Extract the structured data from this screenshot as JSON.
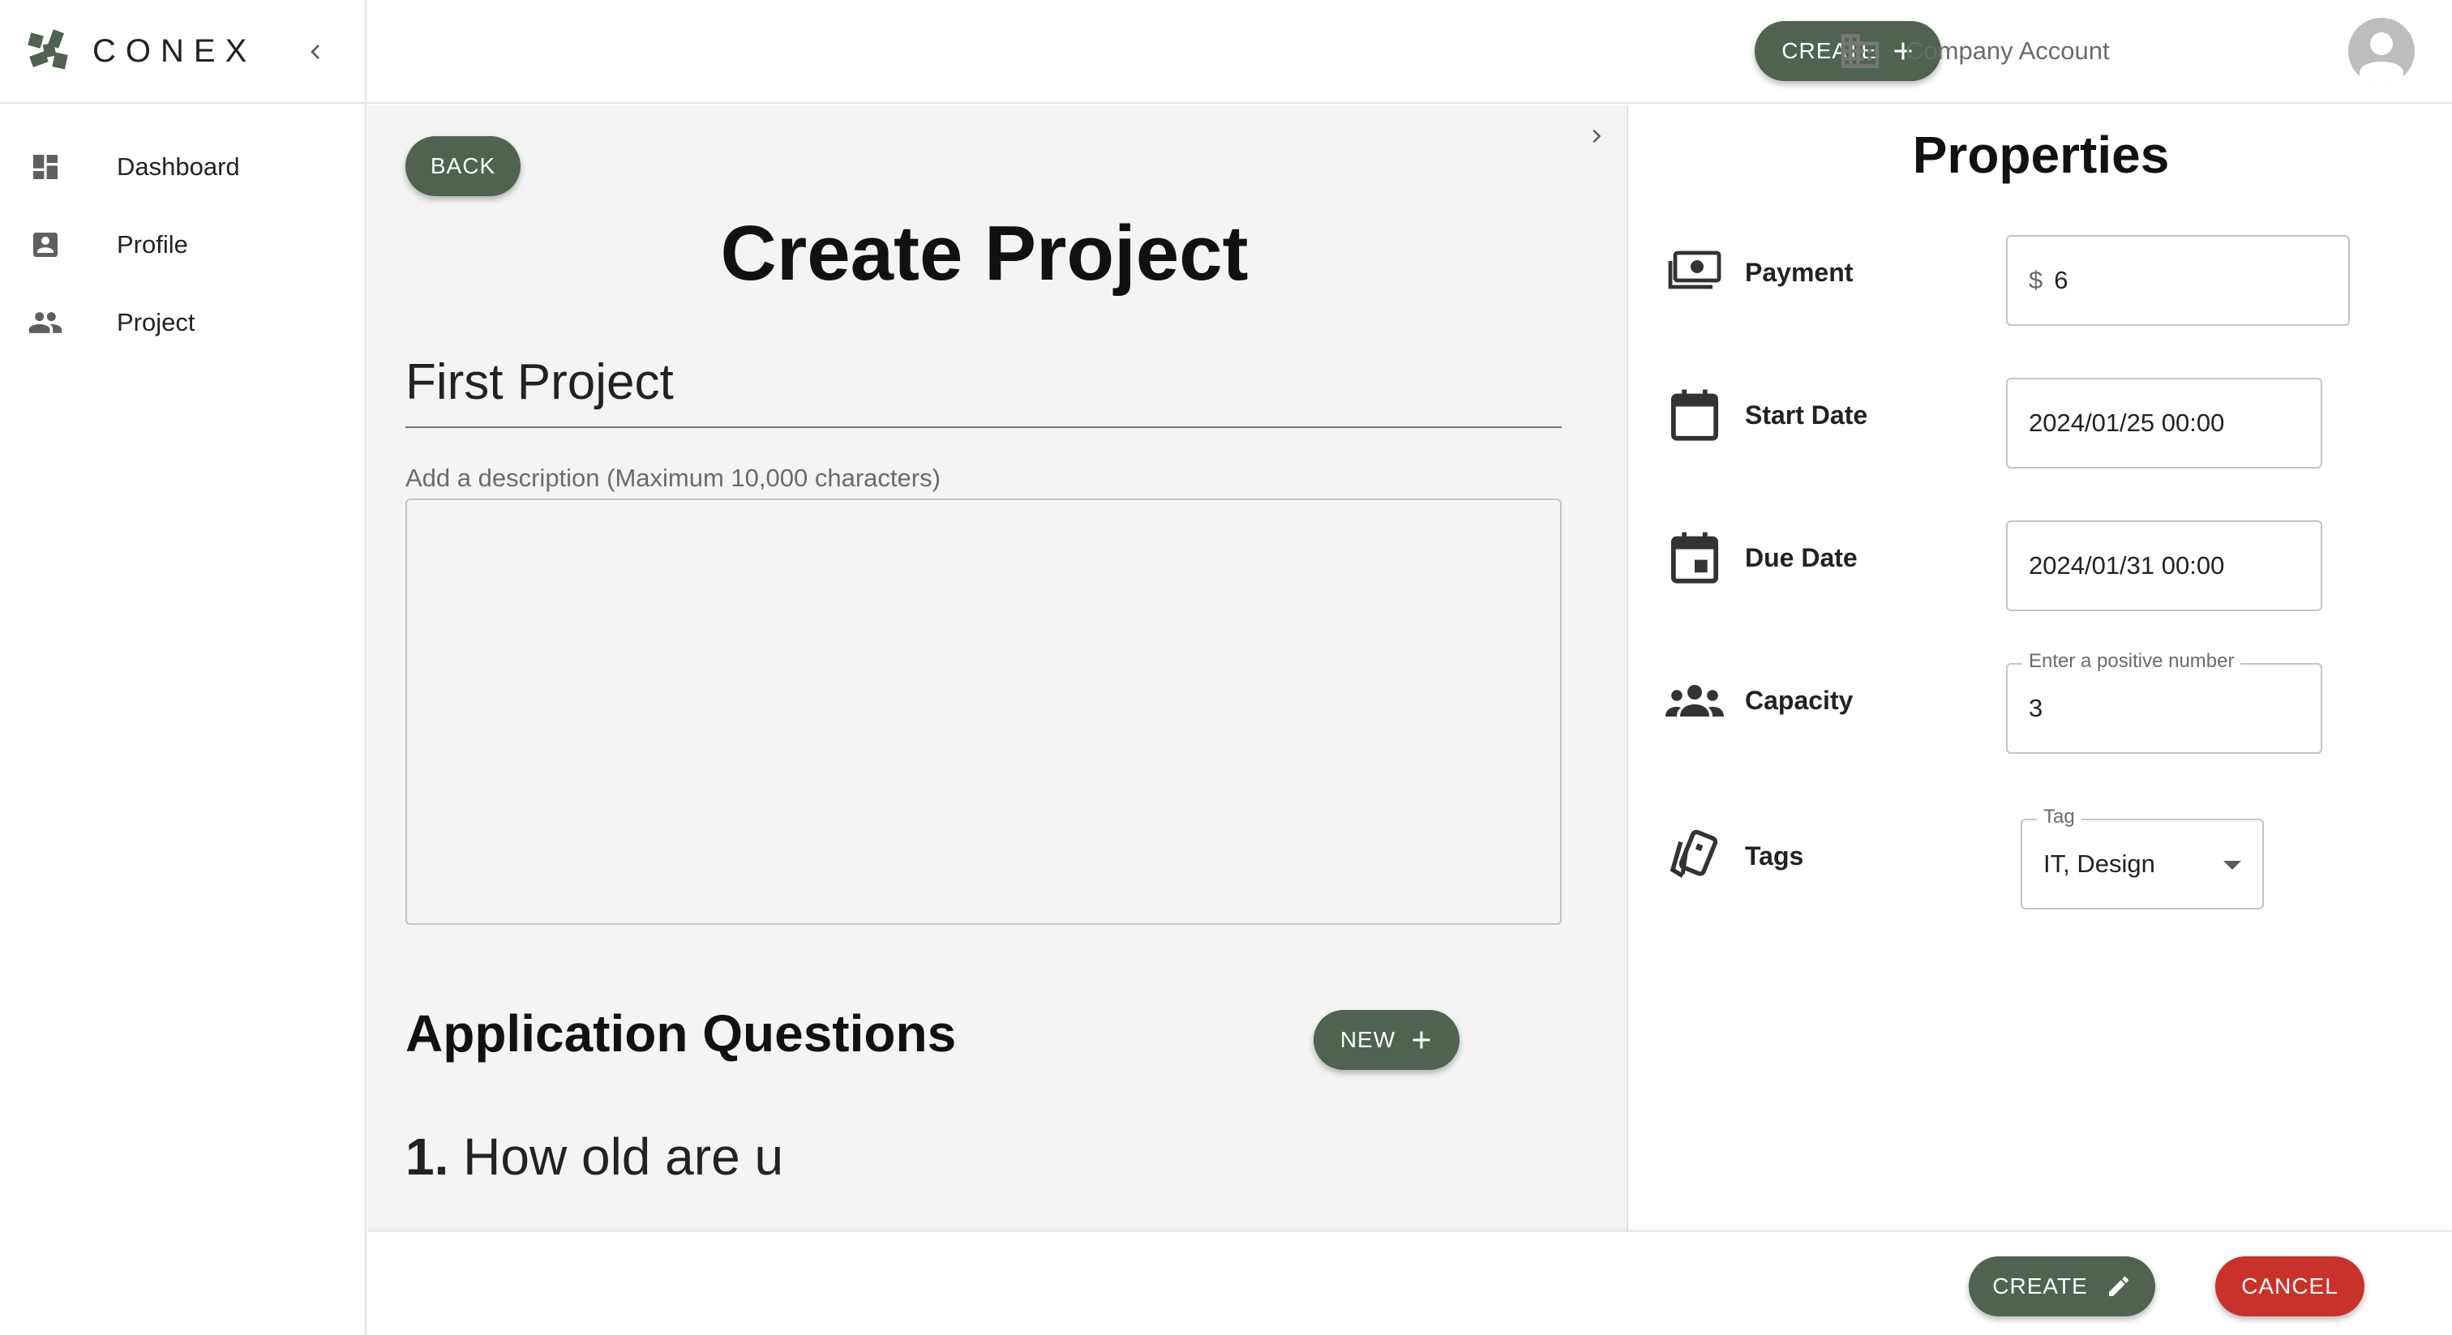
{
  "app": {
    "brand": "CONEX",
    "accent_color": "#4f6350",
    "danger_color": "#c8322b"
  },
  "sidebar": {
    "items": [
      {
        "label": "Dashboard",
        "icon": "dashboard-icon"
      },
      {
        "label": "Profile",
        "icon": "profile-icon"
      },
      {
        "label": "Project",
        "icon": "people-icon"
      }
    ]
  },
  "topbar": {
    "create_label": "CREATE",
    "company_label": "Company Account"
  },
  "main": {
    "back_label": "BACK",
    "title": "Create Project",
    "project_name": "First Project",
    "description_placeholder": "Add a description (Maximum 10,000 characters)",
    "description_value": "",
    "questions_title": "Application Questions",
    "new_label": "NEW",
    "questions": [
      {
        "number": "1.",
        "text": "How old are u"
      }
    ]
  },
  "properties": {
    "title": "Properties",
    "payment": {
      "label": "Payment",
      "prefix": "$",
      "value": "6"
    },
    "start_date": {
      "label": "Start Date",
      "value": "2024/01/25 00:00"
    },
    "due_date": {
      "label": "Due Date",
      "value": "2024/01/31 00:00"
    },
    "capacity": {
      "label": "Capacity",
      "legend": "Enter a positive number",
      "value": "3"
    },
    "tags": {
      "label": "Tags",
      "legend": "Tag",
      "value": "IT, Design"
    }
  },
  "footer": {
    "create_label": "CREATE",
    "cancel_label": "CANCEL"
  }
}
